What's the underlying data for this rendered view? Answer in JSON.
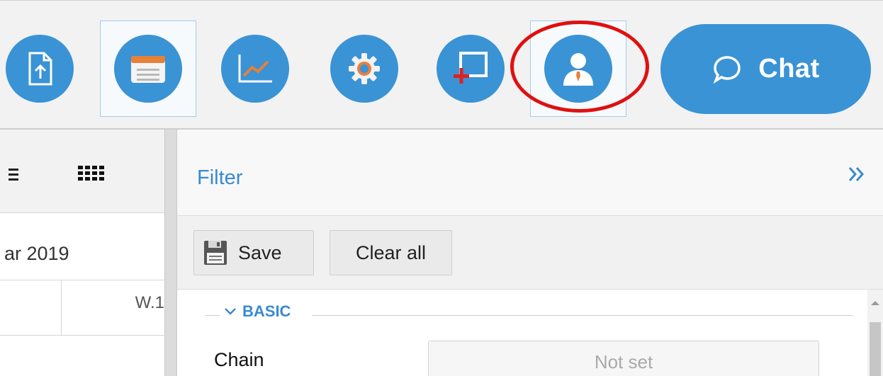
{
  "toolbar": {
    "buttons": [
      {
        "id": "upload",
        "icon": "file-upload-icon"
      },
      {
        "id": "calendar",
        "icon": "calendar-icon"
      },
      {
        "id": "chart",
        "icon": "line-chart-icon"
      },
      {
        "id": "settings",
        "icon": "gear-icon"
      },
      {
        "id": "add-window",
        "icon": "add-window-icon"
      },
      {
        "id": "user",
        "icon": "user-profile-icon"
      }
    ],
    "chat_label": "Chat"
  },
  "left_panel": {
    "date_text": "ar 2019",
    "week_text": "W.1"
  },
  "filter": {
    "title": "Filter",
    "save_label": "Save",
    "clear_label": "Clear all",
    "group_label": "BASIC",
    "fields": [
      {
        "label": "Chain",
        "value": "Not set"
      }
    ]
  },
  "colors": {
    "accent": "#3a93d4",
    "highlight": "#e01010",
    "link": "#3a8ad0"
  }
}
